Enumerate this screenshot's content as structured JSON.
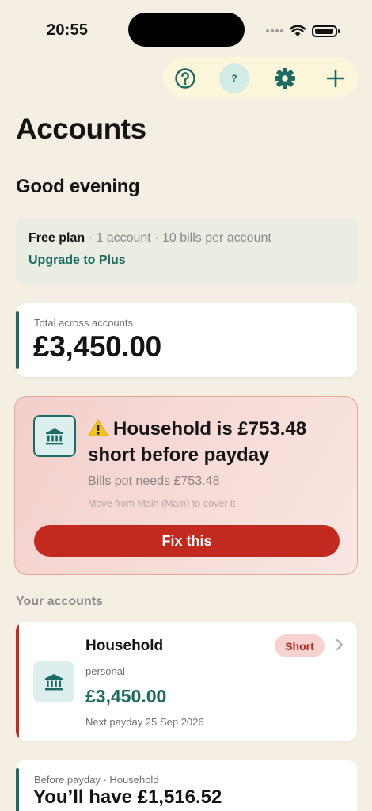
{
  "status_bar": {
    "time": "20:55",
    "battery_level": 0.95
  },
  "toolbar": {
    "help_icon": "help-circle-icon",
    "avatar_label": "?",
    "settings_icon": "gear-icon",
    "add_icon": "plus-icon"
  },
  "page": {
    "title": "Accounts",
    "greeting": "Good evening"
  },
  "plan": {
    "name": "Free plan",
    "meta": " · 1 account · 10 bills per account",
    "upgrade_label": "Upgrade to Plus"
  },
  "total": {
    "label": "Total across accounts",
    "value": "£3,450.00"
  },
  "alert": {
    "icon": "bank-icon",
    "emoji": "⚠️",
    "title": "Household is £753.48 short before payday",
    "subtitle": "Bills pot needs £753.48",
    "hint": "Move from Main (Main) to cover it",
    "button_label": "Fix this"
  },
  "section": {
    "your_accounts": "Your accounts"
  },
  "account": {
    "icon": "bank-icon",
    "name": "Household",
    "type": "personal",
    "balance": "£3,450.00",
    "payday": "Next payday 25 Sep 2026",
    "status": "Short"
  },
  "forecast": {
    "label": "Before payday · Household",
    "value": "You’ll have £1,516.52"
  },
  "colors": {
    "background": "#f5eee2",
    "accent_teal": "#1b6b62",
    "danger_red": "#c22a1f",
    "toolbar_bg": "#fbf6d9"
  }
}
